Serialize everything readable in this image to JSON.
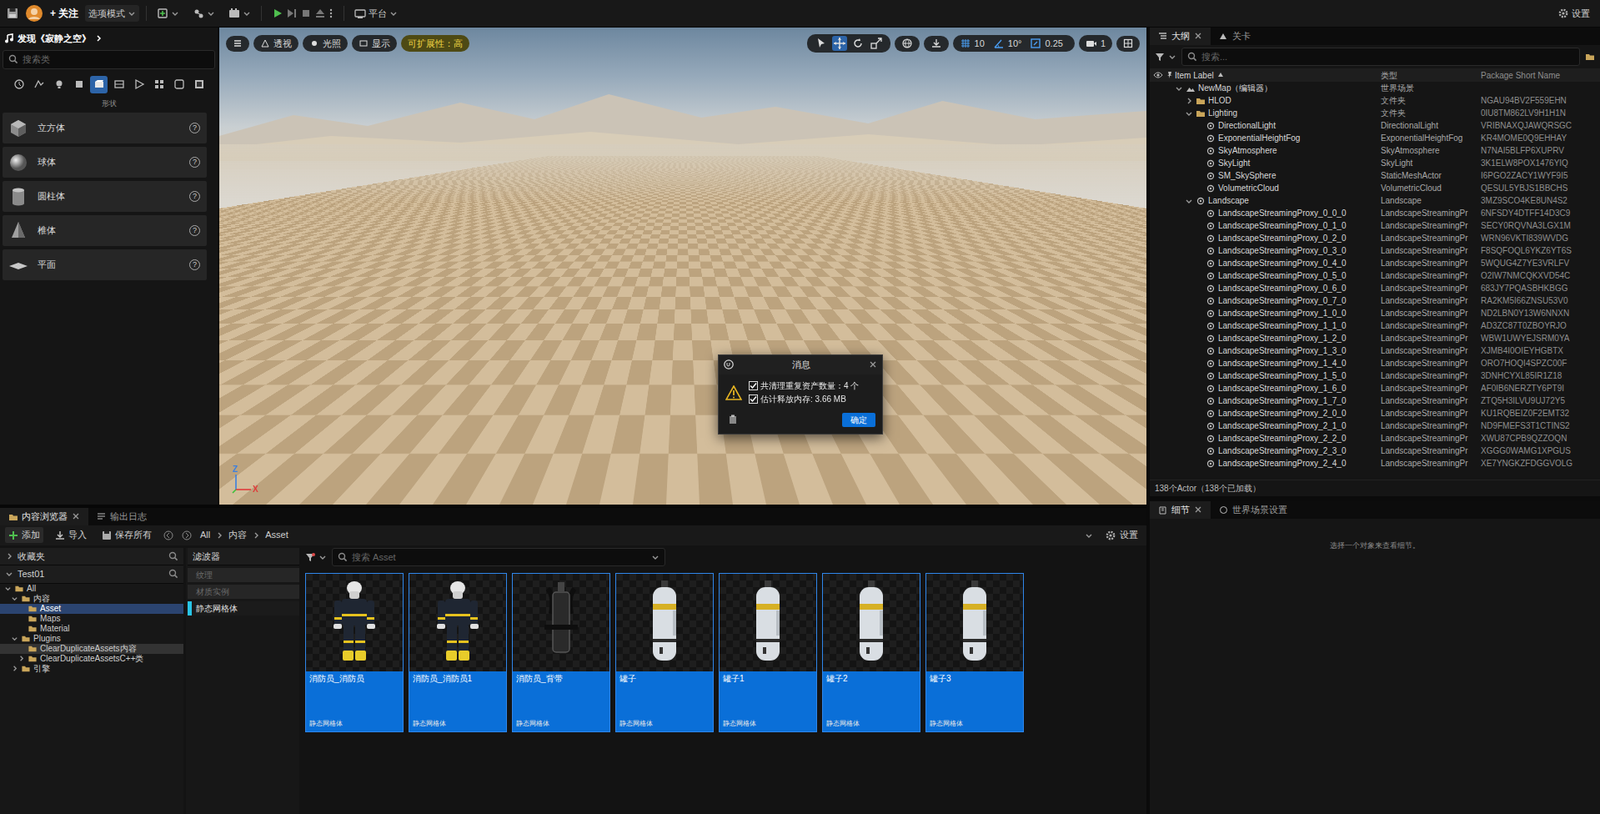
{
  "toolbar": {
    "follow": "+ 关注",
    "mode": "选项模式",
    "platform": "平台",
    "settings": "设置"
  },
  "overlay": {
    "text": "发现《寂静之空》"
  },
  "place_panel": {
    "search_placeholder": "搜索类",
    "categories": [
      {
        "selected": false
      },
      {
        "selected": false
      },
      {
        "selected": false
      },
      {
        "selected": false
      },
      {
        "selected": true
      },
      {
        "selected": false
      },
      {
        "selected": false
      },
      {
        "selected": false
      },
      {
        "selected": false
      },
      {
        "selected": false
      }
    ],
    "section": "形状",
    "help": "?",
    "items": [
      {
        "name": "立方体",
        "kind": "cube"
      },
      {
        "name": "球体",
        "kind": "sphere"
      },
      {
        "name": "圆柱体",
        "kind": "cylinder"
      },
      {
        "name": "椎体",
        "kind": "cone"
      },
      {
        "name": "平面",
        "kind": "plane"
      }
    ]
  },
  "viewport": {
    "buttons": [
      "透视",
      "光照",
      "显示"
    ],
    "scalability": "可扩展性：高",
    "tools": [
      {
        "kind": "select",
        "selected": false
      },
      {
        "kind": "move",
        "selected": true
      },
      {
        "kind": "rotate",
        "selected": false
      },
      {
        "kind": "scale",
        "selected": false
      }
    ],
    "snaps": [
      {
        "kind": "grid",
        "value": "10",
        "on": true
      },
      {
        "kind": "angle",
        "value": "10°",
        "on": true
      },
      {
        "kind": "scale",
        "value": "0.25",
        "on": true
      }
    ],
    "camera_speed": "1",
    "axes": [
      "Z",
      "X"
    ]
  },
  "dialog": {
    "title": "消息",
    "lines": [
      {
        "text": "共清理重复资产数量：4 个",
        "checked": true
      },
      {
        "text": "估计释放内存: 3.66 MB",
        "checked": true
      }
    ],
    "button": "确定"
  },
  "outliner": {
    "tabs": [
      {
        "label": "大纲",
        "selected": true,
        "closable": true
      },
      {
        "label": "关卡",
        "selected": false,
        "closable": false
      }
    ],
    "search_placeholder": "搜索...",
    "columns": [
      {
        "label": "Item Label",
        "sorted": true
      },
      {
        "label": "类型",
        "sorted": false
      },
      {
        "label": "Package Short Name",
        "sorted": false
      }
    ],
    "rows": [
      {
        "label": "NewMap（编辑器）",
        "type": "世界场景",
        "depth": 0,
        "kind": "world",
        "expandable": true,
        "expanded": true
      },
      {
        "label": "HLOD",
        "type": "文件夹",
        "package": "NGAU94BV2F559EHN",
        "depth": 1,
        "kind": "folder",
        "expandable": true,
        "expanded": false
      },
      {
        "label": "Lighting",
        "type": "文件夹",
        "package": "0IU8TM862LV9H1H1N",
        "depth": 1,
        "kind": "folder",
        "expandable": true,
        "expanded": true
      },
      {
        "label": "DirectionalLight",
        "type": "DirectionalLight",
        "package": "VRIBNAXQJAWQRSGC",
        "depth": 2,
        "kind": "actor",
        "expandable": false,
        "expanded": false
      },
      {
        "label": "ExponentialHeightFog",
        "type": "ExponentialHeightFog",
        "package": "KR4MOME0Q9EHHAY",
        "depth": 2,
        "kind": "actor",
        "expandable": false,
        "expanded": false
      },
      {
        "label": "SkyAtmosphere",
        "type": "SkyAtmosphere",
        "package": "N7NAI5BLFP6XUPRV",
        "depth": 2,
        "kind": "actor",
        "expandable": false,
        "expanded": false
      },
      {
        "label": "SkyLight",
        "type": "SkyLight",
        "package": "3K1ELW8POX1476YIQ",
        "depth": 2,
        "kind": "actor",
        "expandable": false,
        "expanded": false
      },
      {
        "label": "SM_SkySphere",
        "type": "StaticMeshActor",
        "package": "I6PGO2ZACY1WYF9I5",
        "depth": 2,
        "kind": "actor",
        "expandable": false,
        "expanded": false
      },
      {
        "label": "VolumetricCloud",
        "type": "VolumetricCloud",
        "package": "QESUL5YBJS1BBCHS",
        "depth": 2,
        "kind": "actor",
        "expandable": false,
        "expanded": false
      },
      {
        "label": "Landscape",
        "type": "Landscape",
        "package": "3MZ9SCO4KE8UN4S2",
        "depth": 1,
        "kind": "actor",
        "expandable": true,
        "expanded": true
      },
      {
        "label": "LandscapeStreamingProxy_0_0_0",
        "type": "LandscapeStreamingPr",
        "package": "6NFSDY4DTFF14D3C9",
        "depth": 2,
        "kind": "actor",
        "expandable": false,
        "expanded": false
      },
      {
        "label": "LandscapeStreamingProxy_0_1_0",
        "type": "LandscapeStreamingPr",
        "package": "SECY0RQVNA3LGX1M",
        "depth": 2,
        "kind": "actor",
        "expandable": false,
        "expanded": false
      },
      {
        "label": "LandscapeStreamingProxy_0_2_0",
        "type": "LandscapeStreamingPr",
        "package": "WRN96VKTI839WVDG",
        "depth": 2,
        "kind": "actor",
        "expandable": false,
        "expanded": false
      },
      {
        "label": "LandscapeStreamingProxy_0_3_0",
        "type": "LandscapeStreamingPr",
        "package": "F8SQFOQL6YKZ6YT6S",
        "depth": 2,
        "kind": "actor",
        "expandable": false,
        "expanded": false
      },
      {
        "label": "LandscapeStreamingProxy_0_4_0",
        "type": "LandscapeStreamingPr",
        "package": "5WQUG4Z7YE3VRLFV",
        "depth": 2,
        "kind": "actor",
        "expandable": false,
        "expanded": false
      },
      {
        "label": "LandscapeStreamingProxy_0_5_0",
        "type": "LandscapeStreamingPr",
        "package": "O2IW7NMCQKXVD54C",
        "depth": 2,
        "kind": "actor",
        "expandable": false,
        "expanded": false
      },
      {
        "label": "LandscapeStreamingProxy_0_6_0",
        "type": "LandscapeStreamingPr",
        "package": "683JY7PQASBHKBGG",
        "depth": 2,
        "kind": "actor",
        "expandable": false,
        "expanded": false
      },
      {
        "label": "LandscapeStreamingProxy_0_7_0",
        "type": "LandscapeStreamingPr",
        "package": "RA2KM5I66ZNSU53V0",
        "depth": 2,
        "kind": "actor",
        "expandable": false,
        "expanded": false
      },
      {
        "label": "LandscapeStreamingProxy_1_0_0",
        "type": "LandscapeStreamingPr",
        "package": "ND2LBN0Y13W6NNXN",
        "depth": 2,
        "kind": "actor",
        "expandable": false,
        "expanded": false
      },
      {
        "label": "LandscapeStreamingProxy_1_1_0",
        "type": "LandscapeStreamingPr",
        "package": "AD3ZC87T0ZBOYRJO",
        "depth": 2,
        "kind": "actor",
        "expandable": false,
        "expanded": false
      },
      {
        "label": "LandscapeStreamingProxy_1_2_0",
        "type": "LandscapeStreamingPr",
        "package": "WBW1UWYEJSRM0YA",
        "depth": 2,
        "kind": "actor",
        "expandable": false,
        "expanded": false
      },
      {
        "label": "LandscapeStreamingProxy_1_3_0",
        "type": "LandscapeStreamingPr",
        "package": "XJMB4I0OIEYHGBTX",
        "depth": 2,
        "kind": "actor",
        "expandable": false,
        "expanded": false
      },
      {
        "label": "LandscapeStreamingProxy_1_4_0",
        "type": "LandscapeStreamingPr",
        "package": "ORO7HOQI4SPZC00F",
        "depth": 2,
        "kind": "actor",
        "expandable": false,
        "expanded": false
      },
      {
        "label": "LandscapeStreamingProxy_1_5_0",
        "type": "LandscapeStreamingPr",
        "package": "3DNHCYXL85IR1Z18",
        "depth": 2,
        "kind": "actor",
        "expandable": false,
        "expanded": false
      },
      {
        "label": "LandscapeStreamingProxy_1_6_0",
        "type": "LandscapeStreamingPr",
        "package": "AF0IB6NERZTY6PT9I",
        "depth": 2,
        "kind": "actor",
        "expandable": false,
        "expanded": false
      },
      {
        "label": "LandscapeStreamingProxy_1_7_0",
        "type": "LandscapeStreamingPr",
        "package": "ZTQ5H3ILVU9UJ72Y5",
        "depth": 2,
        "kind": "actor",
        "expandable": false,
        "expanded": false
      },
      {
        "label": "LandscapeStreamingProxy_2_0_0",
        "type": "LandscapeStreamingPr",
        "package": "KU1RQBEIZ0F2EMT32",
        "depth": 2,
        "kind": "actor",
        "expandable": false,
        "expanded": false
      },
      {
        "label": "LandscapeStreamingProxy_2_1_0",
        "type": "LandscapeStreamingPr",
        "package": "ND9FMEFS3T1CTINS2",
        "depth": 2,
        "kind": "actor",
        "expandable": false,
        "expanded": false
      },
      {
        "label": "LandscapeStreamingProxy_2_2_0",
        "type": "LandscapeStreamingPr",
        "package": "XWU87CPB9QZZOQN",
        "depth": 2,
        "kind": "actor",
        "expandable": false,
        "expanded": false
      },
      {
        "label": "LandscapeStreamingProxy_2_3_0",
        "type": "LandscapeStreamingPr",
        "package": "XGGG0WAMG1XPGUS",
        "depth": 2,
        "kind": "actor",
        "expandable": false,
        "expanded": false
      },
      {
        "label": "LandscapeStreamingProxy_2_4_0",
        "type": "LandscapeStreamingPr",
        "package": "XE7YNGKZFDGGVOLG",
        "depth": 2,
        "kind": "actor",
        "expandable": false,
        "expanded": false
      }
    ],
    "footer": "138个Actor（138个已加载）"
  },
  "details": {
    "tabs": [
      {
        "label": "细节",
        "selected": true,
        "closable": true
      },
      {
        "label": "世界场景设置",
        "selected": false,
        "closable": false
      }
    ],
    "hint": "选择一个对象来查看细节。"
  },
  "content_browser": {
    "tabs": [
      {
        "label": "内容浏览器",
        "selected": true,
        "closable": true
      },
      {
        "label": "输出日志",
        "selected": false,
        "closable": false
      }
    ],
    "actions": [
      "添加",
      "导入",
      "保存所有"
    ],
    "breadcrumb": [
      "All",
      "内容",
      "Asset"
    ],
    "settings": "设置",
    "favorites": "收藏夹",
    "project": "Test01",
    "tree": [
      {
        "label": "All",
        "depth": 0,
        "expandable": true,
        "expanded": true,
        "selected": false,
        "hovered": false
      },
      {
        "label": "内容",
        "depth": 1,
        "expandable": true,
        "expanded": true,
        "selected": false,
        "hovered": false
      },
      {
        "label": "Asset",
        "depth": 2,
        "expandable": false,
        "expanded": false,
        "selected": true,
        "hovered": false
      },
      {
        "label": "Maps",
        "depth": 2,
        "expandable": false,
        "expanded": false,
        "selected": false,
        "hovered": false
      },
      {
        "label": "Material",
        "depth": 2,
        "expandable": false,
        "expanded": false,
        "selected": false,
        "hovered": false
      },
      {
        "label": "Plugins",
        "depth": 1,
        "expandable": true,
        "expanded": true,
        "selected": false,
        "hovered": false
      },
      {
        "label": "ClearDuplicateAssets内容",
        "depth": 2,
        "expandable": false,
        "expanded": false,
        "selected": false,
        "hovered": true
      },
      {
        "label": "ClearDuplicateAssetsC++类",
        "depth": 2,
        "expandable": true,
        "expanded": false,
        "selected": false,
        "hovered": false
      },
      {
        "label": "引擎",
        "depth": 1,
        "expandable": true,
        "expanded": false,
        "selected": false,
        "hovered": false
      }
    ],
    "filters_title": "滤波器",
    "filters": [
      {
        "label": "纹理",
        "on": false
      },
      {
        "label": "材质实例",
        "on": false
      },
      {
        "label": "静态网格体",
        "on": true
      }
    ],
    "search_placeholder": "搜索 Asset",
    "assets": [
      {
        "name": "消防员_消防员",
        "type": "静态网格体",
        "kind": "firefighter",
        "selected": true
      },
      {
        "name": "消防员_消防员1",
        "type": "静态网格体",
        "kind": "firefighter",
        "selected": true
      },
      {
        "name": "消防员_背带",
        "type": "静态网格体",
        "kind": "harness",
        "selected": true
      },
      {
        "name": "罐子",
        "type": "静态网格体",
        "kind": "tank",
        "selected": true
      },
      {
        "name": "罐子1",
        "type": "静态网格体",
        "kind": "tank",
        "selected": true
      },
      {
        "name": "罐子2",
        "type": "静态网格体",
        "kind": "tank",
        "selected": true
      },
      {
        "name": "罐子3",
        "type": "静态网格体",
        "kind": "tank",
        "selected": true
      }
    ]
  }
}
